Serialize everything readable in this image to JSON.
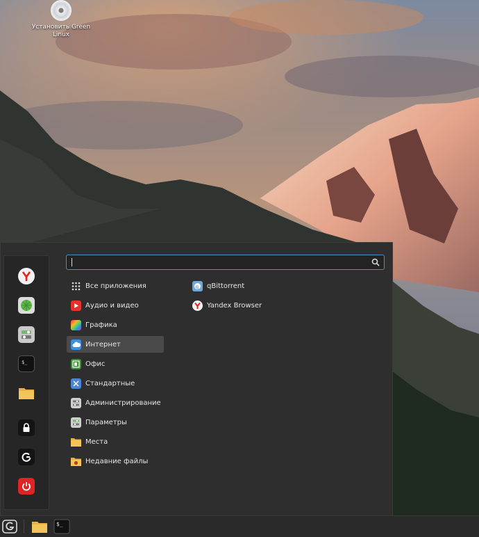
{
  "desktop": {
    "install_icon_label": "Установить Green Linux"
  },
  "menu": {
    "search": {
      "value": "",
      "placeholder": ""
    },
    "favorites": [
      {
        "name": "yandex-browser-favorite",
        "icon": "yandex-icon"
      },
      {
        "name": "mintinstall-favorite",
        "icon": "software-manager-icon"
      },
      {
        "name": "settings-favorite",
        "icon": "settings-icon"
      },
      {
        "name": "terminal-favorite",
        "icon": "terminal-icon"
      },
      {
        "name": "files-favorite",
        "icon": "folder-icon"
      },
      {
        "name": "lock-screen-button",
        "icon": "lock-icon"
      },
      {
        "name": "logout-button",
        "icon": "logout-icon"
      },
      {
        "name": "shutdown-button",
        "icon": "power-icon"
      }
    ],
    "categories": [
      {
        "label": "Все приложения",
        "icon": "grid-icon"
      },
      {
        "label": "Аудио и видео",
        "icon": "play-icon"
      },
      {
        "label": "Графика",
        "icon": "graphics-icon"
      },
      {
        "label": "Интернет",
        "icon": "cloud-icon",
        "active": true
      },
      {
        "label": "Офис",
        "icon": "office-icon"
      },
      {
        "label": "Стандартные",
        "icon": "accessories-icon"
      },
      {
        "label": "Администрирование",
        "icon": "admin-icon"
      },
      {
        "label": "Параметры",
        "icon": "preferences-icon"
      },
      {
        "label": "Места",
        "icon": "folder-icon"
      },
      {
        "label": "Недавние файлы",
        "icon": "recent-icon"
      }
    ],
    "apps": [
      {
        "label": "qBittorrent",
        "icon": "qbittorrent-icon"
      },
      {
        "label": "Yandex Browser",
        "icon": "yandex-icon"
      }
    ]
  },
  "taskbar": {
    "start_button_icon": "green-linux-logo-icon",
    "launchers": [
      "folder-icon",
      "terminal-icon"
    ]
  }
}
